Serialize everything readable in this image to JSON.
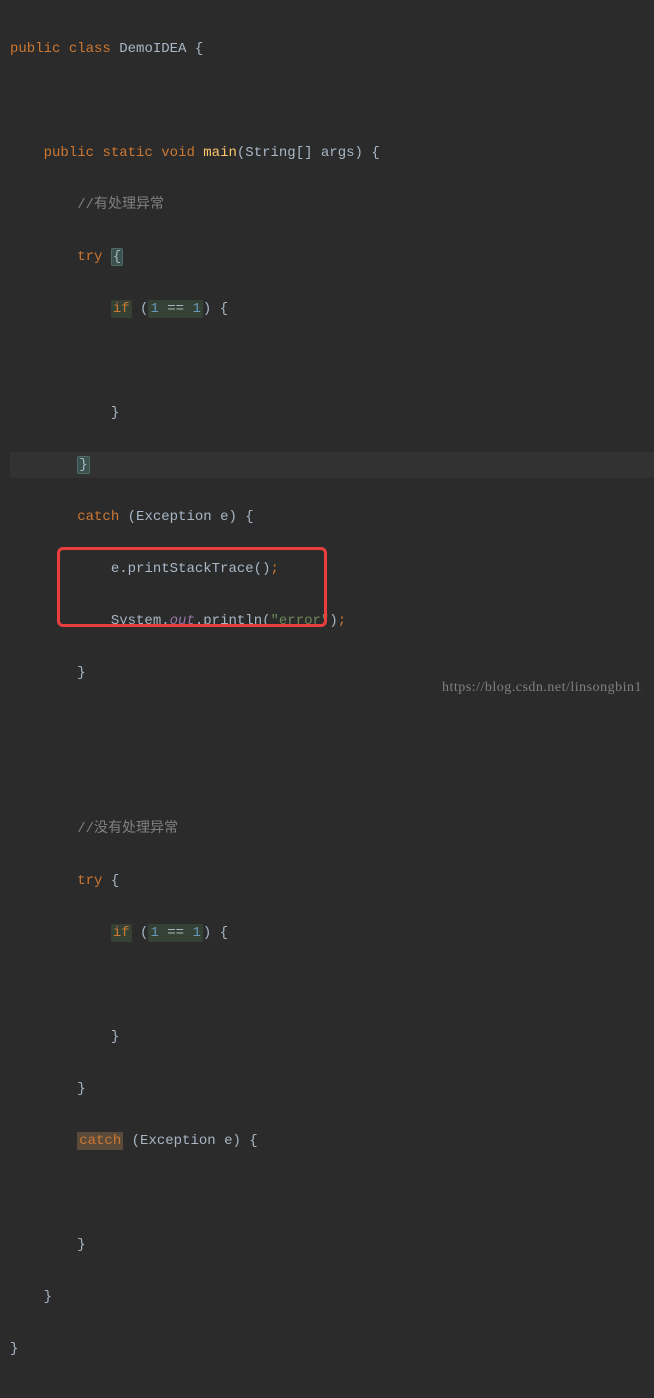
{
  "code": {
    "l1": {
      "kw1": "public",
      "kw2": "class",
      "cls": "DemoIDEA",
      "brace": "{"
    },
    "l2": "",
    "l3": {
      "kw1": "public",
      "kw2": "static",
      "kw3": "void",
      "fn": "main",
      "sig": "(String[] args)",
      "brace": "{"
    },
    "l4": {
      "cmt": "//有处理异常"
    },
    "l5": {
      "kw": "try",
      "brace": "{"
    },
    "l6": {
      "kw": "if",
      "paren_open": "(",
      "n1": "1",
      "op": "==",
      "n2": "1",
      "paren_close": ")",
      "brace": "{"
    },
    "l7": "",
    "l8": {
      "brace": "}"
    },
    "l9": {
      "brace": "}"
    },
    "l10": {
      "kw": "catch",
      "paren_open": "(",
      "type": "Exception",
      "var": "e",
      "paren_close": ")",
      "brace": "{"
    },
    "l11": {
      "obj": "e",
      "dot": ".",
      "meth": "printStackTrace",
      "call": "()",
      "semi": ";"
    },
    "l12": {
      "obj": "System",
      "dot1": ".",
      "it": "out",
      "dot2": ".",
      "meth": "println",
      "paren_open": "(",
      "str": "\"error\"",
      "paren_close": ")",
      "semi": ";"
    },
    "l13": {
      "brace": "}"
    },
    "l14": "",
    "l15": "",
    "l16": {
      "cmt": "//没有处理异常"
    },
    "l17": {
      "kw": "try",
      "brace": "{"
    },
    "l18": {
      "kw": "if",
      "paren_open": "(",
      "n1": "1",
      "op": "==",
      "n2": "1",
      "paren_close": ")",
      "brace": "{"
    },
    "l19": "",
    "l20": {
      "brace": "}"
    },
    "l21": {
      "brace": "}"
    },
    "l22": {
      "kw": "catch",
      "paren_open": "(",
      "type": "Exception",
      "var": "e",
      "paren_close": ")",
      "brace": "{"
    },
    "l23": "",
    "l24": {
      "brace": "}"
    },
    "l25": {
      "brace": "}"
    },
    "l26": {
      "brace": "}"
    }
  },
  "watermark": "https://blog.csdn.net/linsongbin1"
}
